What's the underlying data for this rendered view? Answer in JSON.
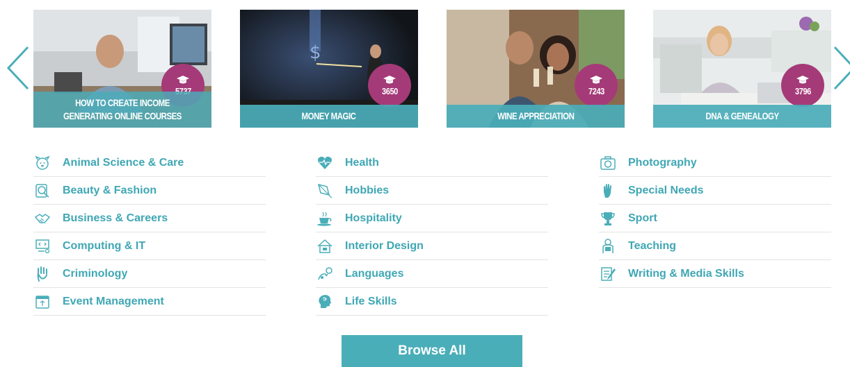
{
  "colors": {
    "accent": "#4aaeb9",
    "link": "#3fa7b4",
    "badge": "#a53a78",
    "divider": "#e3e3e3"
  },
  "carousel": {
    "prev_icon": "chevron-left-icon",
    "next_icon": "chevron-right-icon",
    "cards": [
      {
        "title": "How to Create Income Generating Online Courses",
        "count": "5737",
        "icon": "graduation-cap-icon"
      },
      {
        "title": "Money Magic",
        "count": "3650",
        "icon": "graduation-cap-icon"
      },
      {
        "title": "Wine Appreciation",
        "count": "7243",
        "icon": "graduation-cap-icon"
      },
      {
        "title": "DNA & Genealogy",
        "count": "3796",
        "icon": "graduation-cap-icon"
      }
    ]
  },
  "categories": {
    "col1": [
      {
        "label": "Animal Science & Care",
        "icon": "dog-icon"
      },
      {
        "label": "Beauty & Fashion",
        "icon": "mirror-icon"
      },
      {
        "label": "Business & Careers",
        "icon": "handshake-icon"
      },
      {
        "label": "Computing & IT",
        "icon": "computer-code-icon"
      },
      {
        "label": "Criminology",
        "icon": "handprint-icon"
      },
      {
        "label": "Event Management",
        "icon": "calendar-icon"
      }
    ],
    "col2": [
      {
        "label": "Health",
        "icon": "heartbeat-icon"
      },
      {
        "label": "Hobbies",
        "icon": "kite-icon"
      },
      {
        "label": "Hospitality",
        "icon": "coffee-cup-icon"
      },
      {
        "label": "Interior Design",
        "icon": "house-icon"
      },
      {
        "label": "Languages",
        "icon": "speech-icon"
      },
      {
        "label": "Life Skills",
        "icon": "head-icon"
      }
    ],
    "col3": [
      {
        "label": "Photography",
        "icon": "camera-icon"
      },
      {
        "label": "Special Needs",
        "icon": "hand-icon"
      },
      {
        "label": "Sport",
        "icon": "trophy-icon"
      },
      {
        "label": "Teaching",
        "icon": "teacher-icon"
      },
      {
        "label": "Writing & Media Skills",
        "icon": "notepad-pen-icon"
      }
    ]
  },
  "browse": {
    "label": "Browse All"
  }
}
